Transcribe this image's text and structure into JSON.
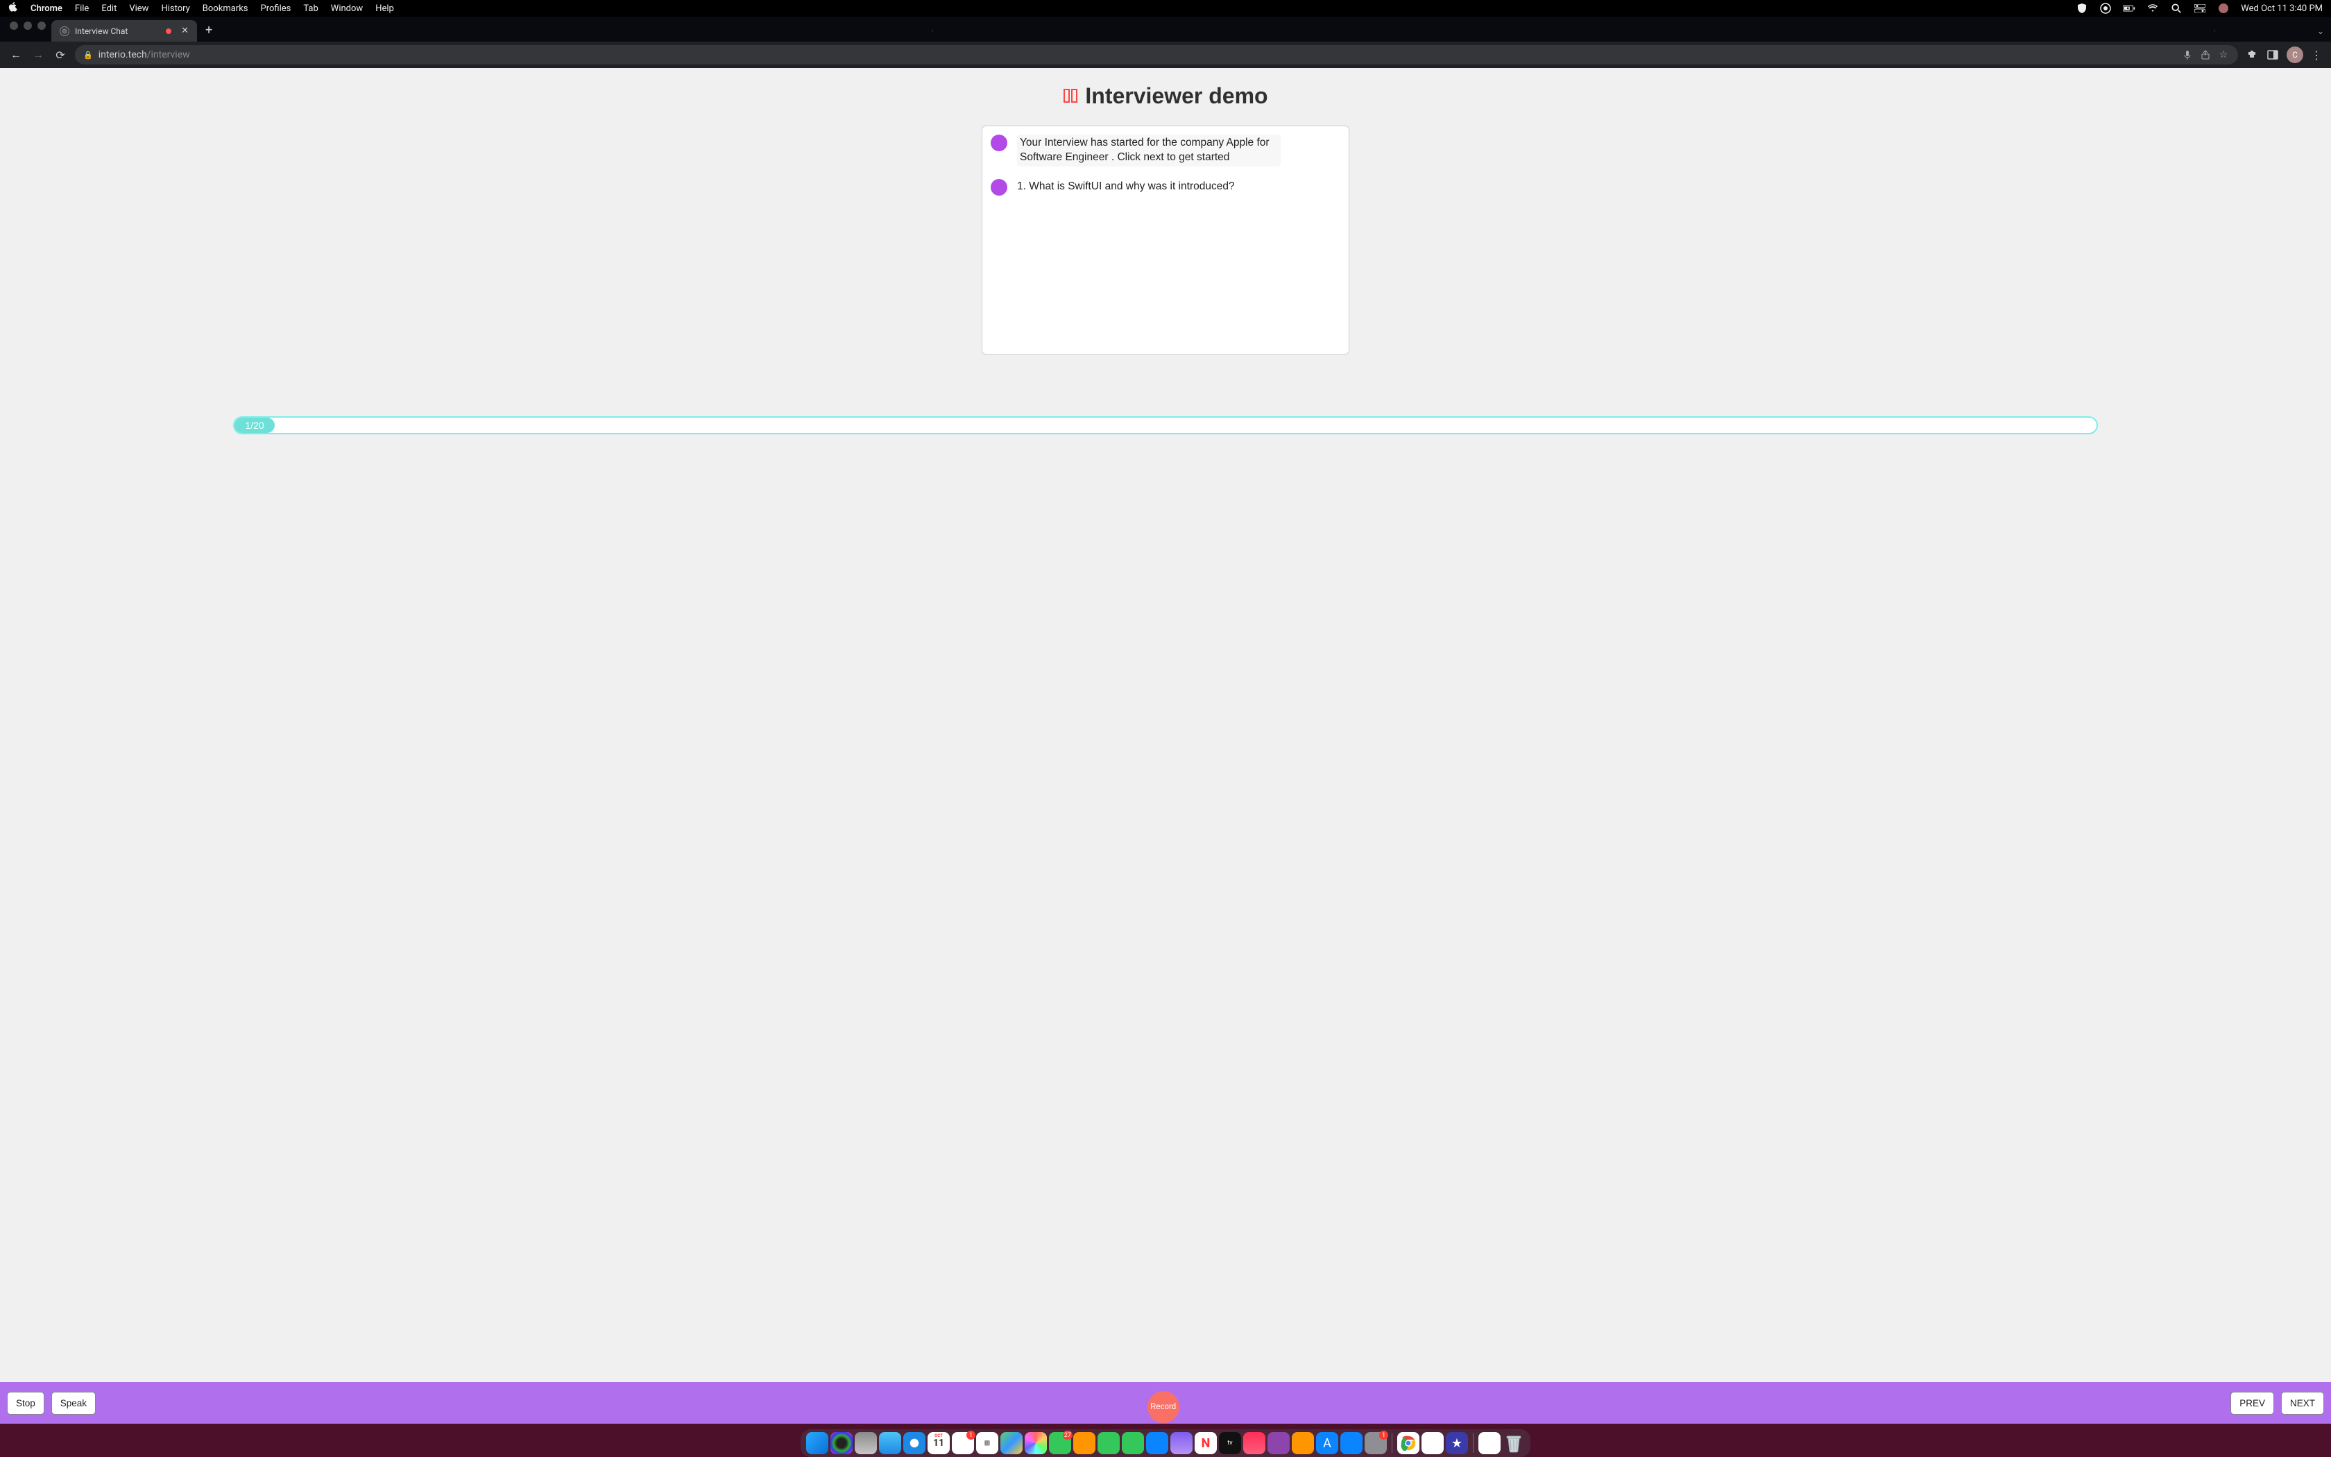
{
  "menubar": {
    "app": "Chrome",
    "items": [
      "File",
      "Edit",
      "View",
      "History",
      "Bookmarks",
      "Profiles",
      "Tab",
      "Window",
      "Help"
    ],
    "clock": "Wed Oct 11  3:40 PM"
  },
  "chrome": {
    "tab_title": "Interview Chat",
    "url_host": "interio.tech",
    "url_path": "/interview",
    "avatar_letter": "C"
  },
  "app": {
    "title": "Interviewer demo",
    "messages": [
      {
        "kind": "bubble",
        "text": "Your Interview has started for the company Apple for Software Engineer . Click next to get started"
      },
      {
        "kind": "plain",
        "text": "1. What is SwiftUI and why was it introduced?"
      }
    ],
    "progress_label": "1/20",
    "controls": {
      "stop": "Stop",
      "speak": "Speak",
      "record": "Record",
      "prev": "PREV",
      "next": "NEXT"
    }
  },
  "dock": {
    "calendar_month": "OCT",
    "calendar_day": "11",
    "badges": {
      "reminders": "1",
      "messages": "27",
      "sys": "1"
    }
  }
}
